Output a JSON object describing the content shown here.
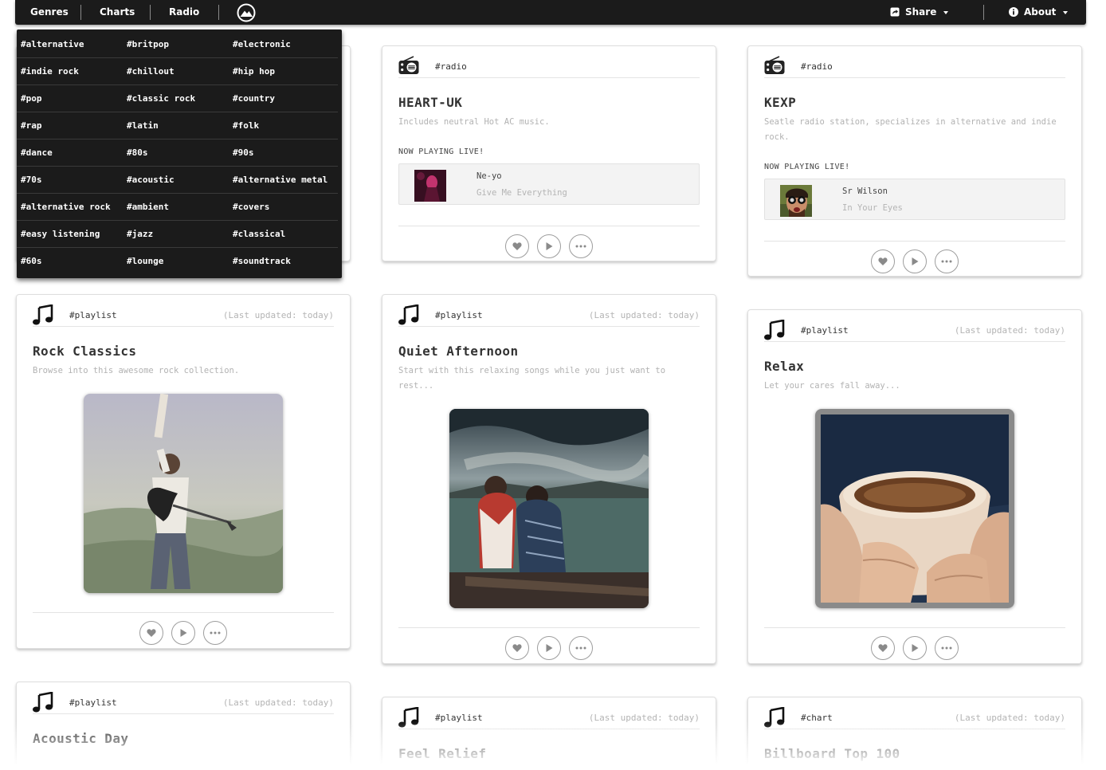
{
  "navbar": {
    "genres": "Genres",
    "charts": "Charts",
    "radio": "Radio",
    "share": "Share",
    "about": "About"
  },
  "genres": [
    "#alternative",
    "#britpop",
    "#electronic",
    "#indie rock",
    "#chillout",
    "#hip hop",
    "#pop",
    "#classic rock",
    "#country",
    "#rap",
    "#latin",
    "#folk",
    "#dance",
    "#80s",
    "#90s",
    "#70s",
    "#acoustic",
    "#alternative metal",
    "#alternative rock",
    "#ambient",
    "#covers",
    "#easy listening",
    "#jazz",
    "#classical",
    "#60s",
    "#lounge",
    "#soundtrack"
  ],
  "cards": {
    "heart_uk": {
      "tag": "#radio",
      "title": "HEART-UK",
      "desc": "Includes neutral Hot AC music.",
      "live": "NOW PLAYING LIVE!",
      "artist": "Ne-yo",
      "song": "Give Me Everything"
    },
    "kexp": {
      "tag": "#radio",
      "title": "KEXP",
      "desc": "Seatle radio station, specializes in alternative and indie rock.",
      "live": "NOW PLAYING LIVE!",
      "artist": "Sr Wilson",
      "song": "In Your Eyes"
    },
    "rock_classics": {
      "tag": "#playlist",
      "updated": "(Last updated: today)",
      "title": "Rock Classics",
      "desc": "Browse into this awesome rock collection."
    },
    "quiet_afternoon": {
      "tag": "#playlist",
      "updated": "(Last updated: today)",
      "title": "Quiet Afternoon",
      "desc": "Start with this relaxing songs while you just want to rest..."
    },
    "relax": {
      "tag": "#playlist",
      "updated": "(Last updated: today)",
      "title": "Relax",
      "desc": "Let your cares fall away..."
    },
    "acoustic_day": {
      "tag": "#playlist",
      "updated": "(Last updated: today)",
      "title": "Acoustic Day"
    },
    "feel_relief": {
      "tag": "#playlist",
      "updated": "(Last updated: today)",
      "title": "Feel Relief"
    },
    "billboard": {
      "tag": "#chart",
      "updated": "(Last updated: today)",
      "title": "Billboard Top 100"
    }
  },
  "icons": {
    "tag_playlist": "music-note-icon",
    "tag_radio": "radio-icon",
    "like": "heart-icon",
    "play": "play-icon",
    "more": "ellipsis-icon"
  }
}
